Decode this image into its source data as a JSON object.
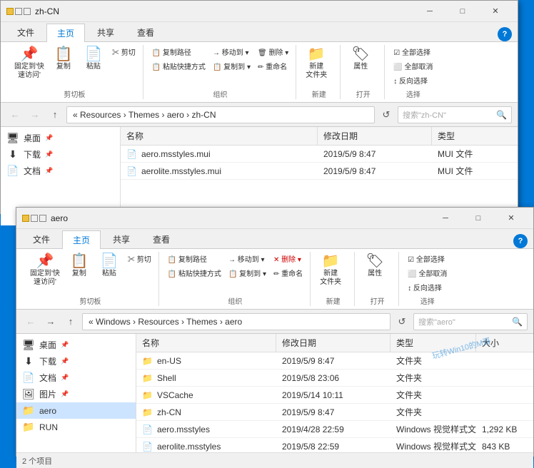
{
  "win1": {
    "title": "zh-CN",
    "tabs": [
      "文件",
      "主页",
      "共享",
      "查看"
    ],
    "active_tab": "主页",
    "ribbon": {
      "groups": [
        {
          "label": "剪切板",
          "items": [
            {
              "type": "big",
              "icon": "📌",
              "label": "固定到'快\n速访问'"
            },
            {
              "type": "big",
              "icon": "📋",
              "label": "复制"
            },
            {
              "type": "big",
              "icon": "📄",
              "label": "粘贴"
            },
            {
              "type": "small_col",
              "items": [
                "✂ 剪切"
              ]
            }
          ]
        },
        {
          "label": "组织",
          "items": [
            {
              "type": "small",
              "icon": "→",
              "label": "复制路径"
            },
            {
              "type": "small",
              "icon": "📋",
              "label": "粘贴快捷方式"
            },
            {
              "type": "small",
              "icon": "→",
              "label": "移动到 ▾"
            },
            {
              "type": "small",
              "icon": "📋",
              "label": "复制到 ▾"
            },
            {
              "type": "small",
              "icon": "🗑",
              "label": "删除 ▾"
            },
            {
              "type": "small",
              "icon": "✏",
              "label": "重命名"
            }
          ]
        },
        {
          "label": "新建",
          "items": [
            {
              "type": "big",
              "icon": "📁",
              "label": "新建\n文件夹"
            }
          ]
        },
        {
          "label": "打开",
          "items": [
            {
              "type": "big",
              "icon": "🏷",
              "label": "属性"
            }
          ]
        },
        {
          "label": "选择",
          "items": [
            {
              "type": "small",
              "label": "全部选择"
            },
            {
              "type": "small",
              "label": "全部取消"
            },
            {
              "type": "small",
              "label": "反向选择"
            }
          ]
        }
      ]
    },
    "address": "« Resources › Themes › aero › zh-CN",
    "search_placeholder": "搜索\"zh-CN\"",
    "columns": [
      "名称",
      "修改日期",
      "类型"
    ],
    "files": [
      {
        "name": "aero.msstyles.mui",
        "date": "2019/5/9 8:47",
        "type": "MUI 文件",
        "size": ""
      },
      {
        "name": "aerolite.msstyles.mui",
        "date": "2019/5/9 8:47",
        "type": "MUI 文件",
        "size": ""
      }
    ],
    "sidebar": [
      {
        "icon": "🖥",
        "label": "桌面",
        "pinned": true
      },
      {
        "icon": "⬇",
        "label": "下载",
        "pinned": true
      },
      {
        "icon": "📄",
        "label": "文档",
        "pinned": true
      }
    ]
  },
  "win2": {
    "title": "aero",
    "tabs": [
      "文件",
      "主页",
      "共享",
      "查看"
    ],
    "active_tab": "主页",
    "address": "« Windows › Resources › Themes › aero",
    "search_placeholder": "搜索\"aero\"",
    "columns": [
      "名称",
      "修改日期",
      "类型",
      "大小"
    ],
    "files": [
      {
        "name": "en-US",
        "date": "2019/5/9 8:47",
        "type": "文件夹",
        "size": "",
        "folder": true
      },
      {
        "name": "Shell",
        "date": "2019/5/8 23:06",
        "type": "文件夹",
        "size": "",
        "folder": true
      },
      {
        "name": "VSCache",
        "date": "2019/5/14 10:11",
        "type": "文件夹",
        "size": "",
        "folder": true
      },
      {
        "name": "zh-CN",
        "date": "2019/5/9 8:47",
        "type": "文件夹",
        "size": "",
        "folder": true
      },
      {
        "name": "aero.msstyles",
        "date": "2019/4/28 22:59",
        "type": "Windows 视觉样式文件",
        "size": "1,292 KB",
        "folder": false
      },
      {
        "name": "aerolite.msstyles",
        "date": "2019/5/8 22:59",
        "type": "Windows 视觉样式文件",
        "size": "843 KB",
        "folder": false
      }
    ],
    "sidebar": [
      {
        "icon": "🖥",
        "label": "桌面",
        "pinned": true
      },
      {
        "icon": "⬇",
        "label": "下载",
        "pinned": true
      },
      {
        "icon": "📄",
        "label": "文档",
        "pinned": true
      },
      {
        "icon": "🖼",
        "label": "图片",
        "pinned": true
      },
      {
        "icon": "📁",
        "label": "aero",
        "pinned": false,
        "folder": true
      },
      {
        "icon": "📁",
        "label": "RUN",
        "pinned": false,
        "folder": true
      }
    ],
    "status": "2 个项目"
  },
  "icons": {
    "back": "←",
    "forward": "→",
    "up": "↑",
    "minimize": "─",
    "maximize": "□",
    "close": "✕",
    "search": "🔍",
    "help": "?"
  }
}
